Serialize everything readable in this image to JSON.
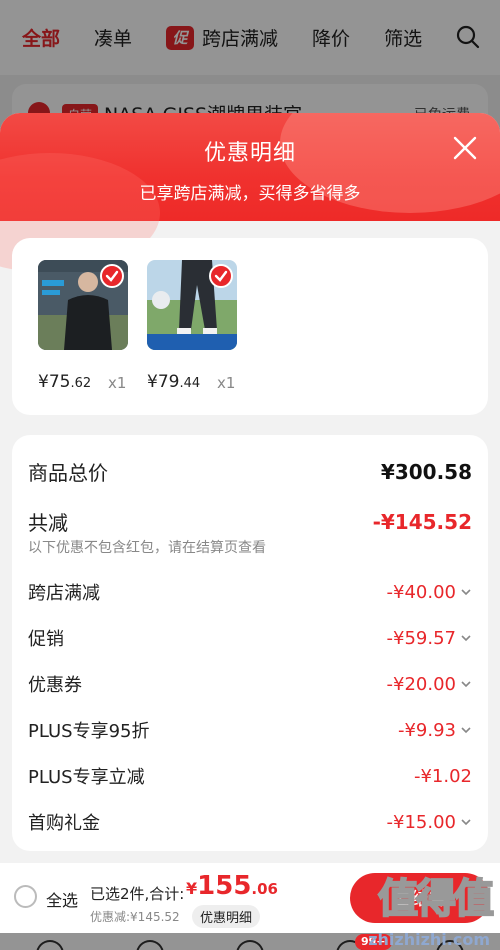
{
  "tabs": [
    {
      "label": "全部"
    },
    {
      "label": "凑单"
    },
    {
      "label": "跨店满减",
      "chip": "促"
    },
    {
      "label": "降价"
    },
    {
      "label": "筛选"
    }
  ],
  "store": {
    "badge": "自营",
    "name": "NASA GISS潮牌男装官",
    "right": "已免运费"
  },
  "sheet": {
    "title": "优惠明细",
    "subtitle": "已享跨店满减，买得多省得多"
  },
  "products": [
    {
      "price_int": "¥75",
      "price_dec": ".62",
      "qty": "x1"
    },
    {
      "price_int": "¥79",
      "price_dec": ".44",
      "qty": "x1"
    }
  ],
  "summary": {
    "total_label": "商品总价",
    "total_value": "¥300.58",
    "discount_label": "共减",
    "discount_value": "-¥145.52",
    "note": "以下优惠不包含红包，请在结算页查看",
    "items": [
      {
        "label": "跨店满减",
        "value": "-¥40.00",
        "expandable": true
      },
      {
        "label": "促销",
        "value": "-¥59.57",
        "expandable": true
      },
      {
        "label": "优惠券",
        "value": "-¥20.00",
        "expandable": true
      },
      {
        "label": "PLUS专享95折",
        "value": "-¥9.93",
        "expandable": true
      },
      {
        "label": "PLUS专享立减",
        "value": "-¥1.02",
        "expandable": false
      },
      {
        "label": "首购礼金",
        "value": "-¥15.00",
        "expandable": true
      }
    ]
  },
  "bottom_bar": {
    "select_all": "全选",
    "selected_info": "已选2件,合计:",
    "total_cur": "¥",
    "total_int": "155",
    "total_dec": ".06",
    "discount_small": "优惠减:¥145.52",
    "detail_chip": "优惠明细",
    "checkout": "去结算",
    "cart_badge": "99+"
  },
  "watermark": {
    "text": "值得值",
    "url": "zhizhizhi.com"
  },
  "colors": {
    "accent": "#e8272b",
    "text": "#222222",
    "muted": "#888888"
  }
}
